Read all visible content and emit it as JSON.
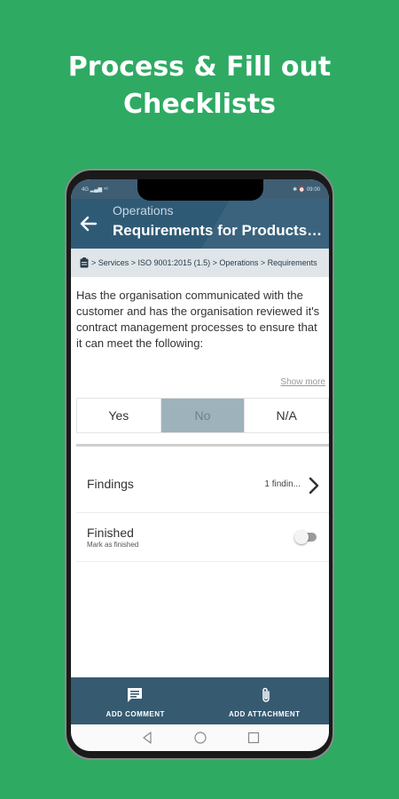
{
  "headline": {
    "line1": "Process & Fill out",
    "line2": "Checklists"
  },
  "statusbar": {
    "left": "4G ▂▄▆ ⁴⁶",
    "right": "✱ ⏰ 09:00"
  },
  "appbar": {
    "subtitle": "Operations",
    "title": "Requirements for Products and Services"
  },
  "breadcrumb": {
    "icon": "clipboard-icon",
    "text": "> Services > ISO 9001:2015 (1.5) > Operations > Requirements"
  },
  "question": {
    "text": "Has the organisation communicated with the customer and has the organisation reviewed it's contract management processes to ensure that it can meet the following:",
    "show_more": "Show more"
  },
  "answers": [
    {
      "label": "Yes",
      "selected": false
    },
    {
      "label": "No",
      "selected": true
    },
    {
      "label": "N/A",
      "selected": false
    }
  ],
  "findings": {
    "label": "Findings",
    "count": "1 findin..."
  },
  "finished": {
    "label": "Finished",
    "sublabel": "Mark as finished",
    "on": false
  },
  "actions": {
    "comment": "ADD COMMENT",
    "attachment": "ADD ATTACHMENT"
  },
  "colors": {
    "background": "#2eaa63",
    "appbar": "#2f5a76",
    "bottombar": "#365a70",
    "selected_answer": "#9eb2bc"
  }
}
